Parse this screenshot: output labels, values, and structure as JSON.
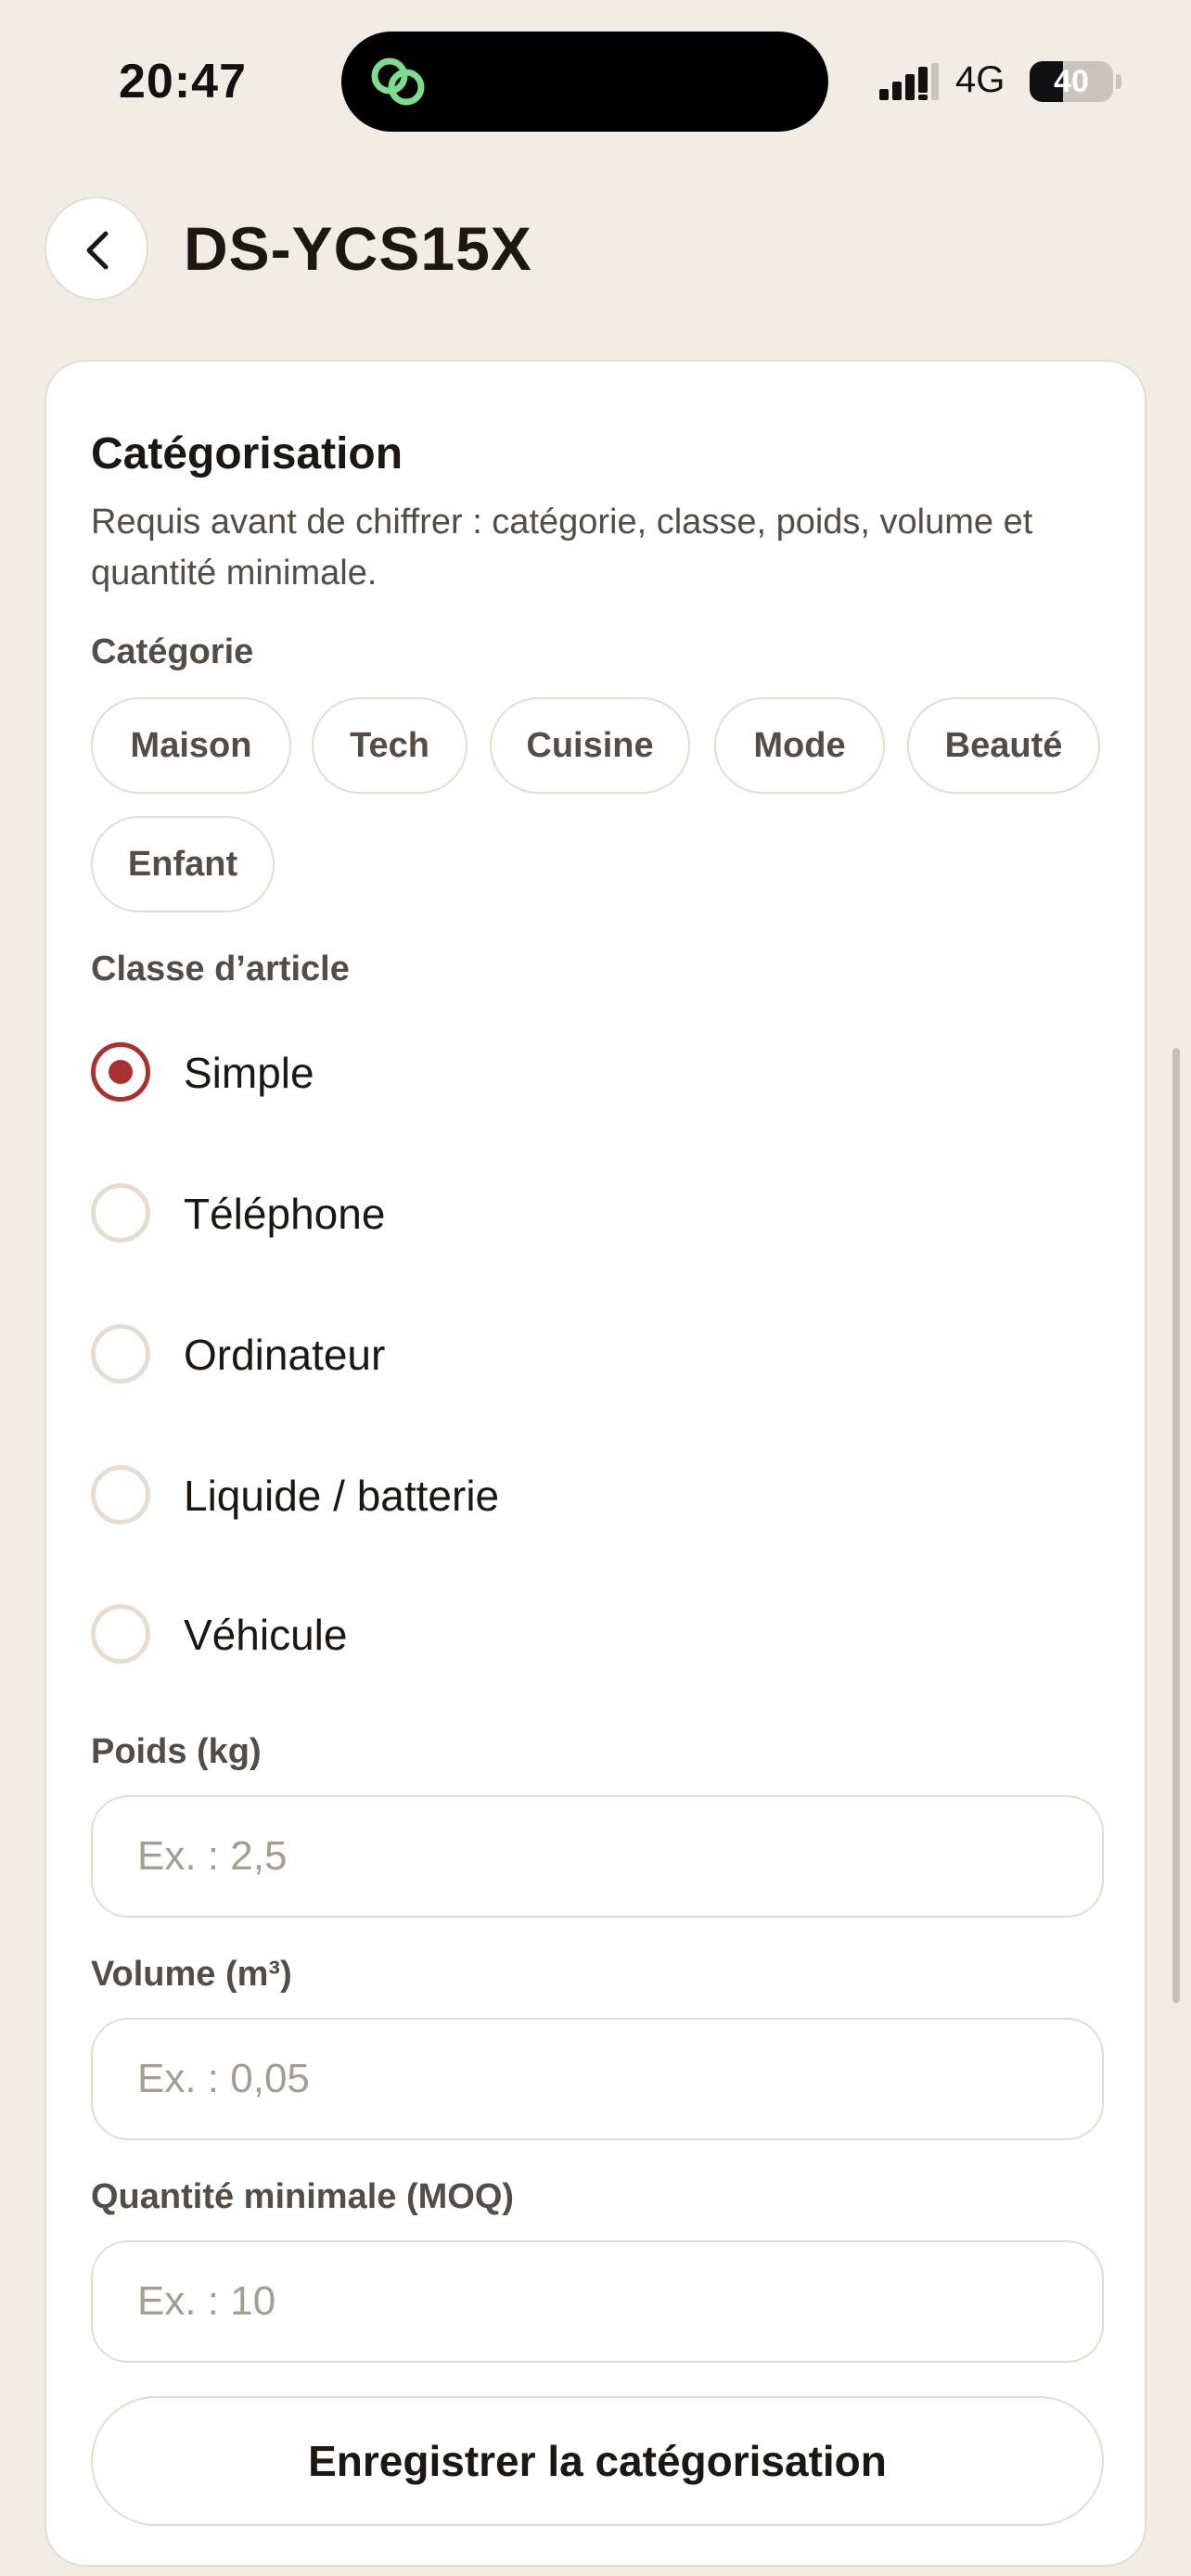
{
  "status_bar": {
    "time": "20:47",
    "network": "4G",
    "battery_level": "40",
    "battery_percent": 40
  },
  "header": {
    "title": "DS-YCS15X",
    "back_icon": "chevron-left-icon"
  },
  "card": {
    "title": "Catégorisation",
    "description": "Requis avant de chiffrer : catégorie, classe, poids, volume et quantité minimale.",
    "category": {
      "label": "Catégorie",
      "chips": [
        "Maison",
        "Tech",
        "Cuisine",
        "Mode",
        "Beauté",
        "Enfant"
      ]
    },
    "item_class": {
      "label": "Classe d’article",
      "options": [
        "Simple",
        "Téléphone",
        "Ordinateur",
        "Liquide / batterie",
        "Véhicule"
      ],
      "selected": "Simple"
    },
    "weight": {
      "label": "Poids (kg)",
      "placeholder": "Ex. : 2,5",
      "value": ""
    },
    "volume": {
      "label": "Volume (m³)",
      "placeholder": "Ex. : 0,05",
      "value": ""
    },
    "moq": {
      "label": "Quantité minimale (MOQ)",
      "placeholder": "Ex. : 10",
      "value": ""
    },
    "save_label": "Enregistrer la catégorisation"
  },
  "colors": {
    "background": "#f1ede5",
    "accent": "#a83232",
    "border": "#e4ddd1",
    "island_icon": "#7fdc8f"
  }
}
